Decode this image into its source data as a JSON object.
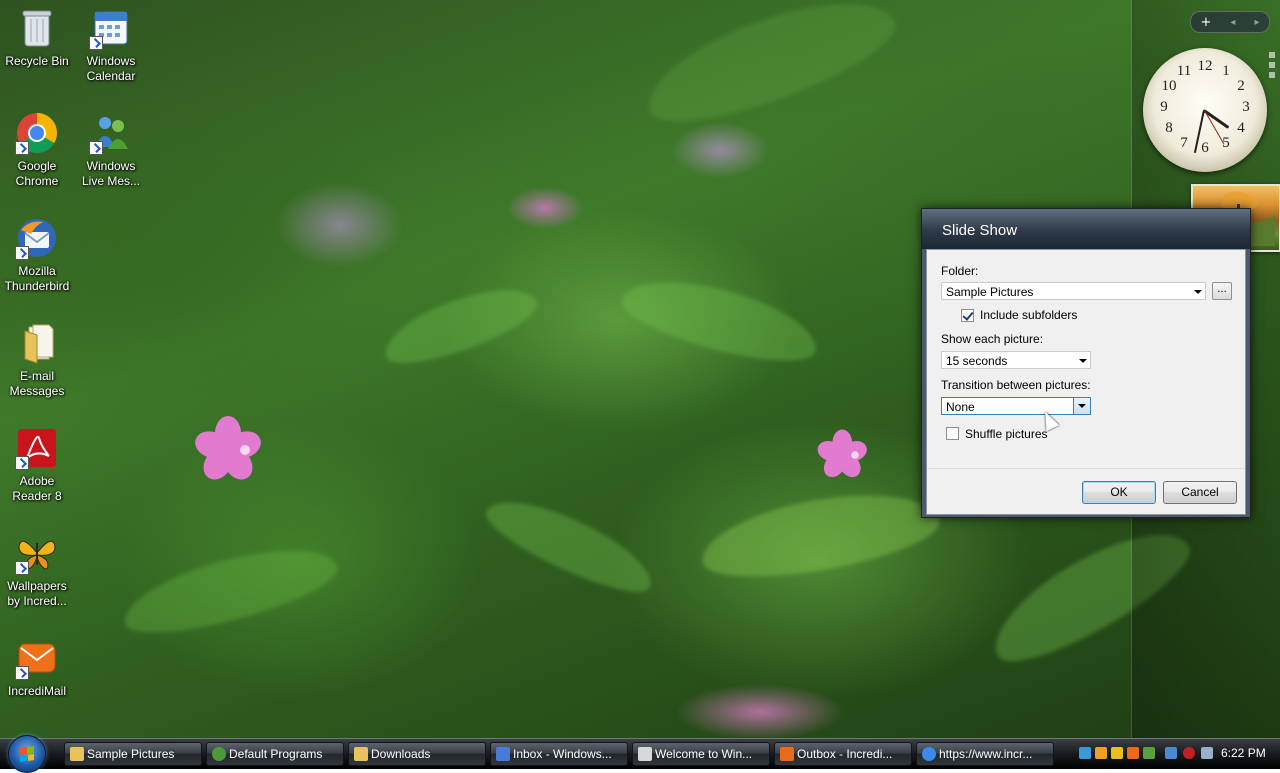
{
  "desktop_icons": [
    {
      "label": "Recycle Bin",
      "icon": "recycle-bin-icon"
    },
    {
      "label": "Windows\nCalendar",
      "icon": "calendar-icon"
    },
    {
      "label": "Google\nChrome",
      "icon": "chrome-icon"
    },
    {
      "label": "Windows\nLive Mes...",
      "icon": "messenger-icon"
    },
    {
      "label": "Mozilla\nThunderbird",
      "icon": "thunderbird-icon"
    },
    {
      "label": "E-mail\nMessages",
      "icon": "folder-icon"
    },
    {
      "label": "Adobe\nReader 8",
      "icon": "adobe-reader-icon"
    },
    {
      "label": "Wallpapers\nby Incred...",
      "icon": "butterfly-icon"
    },
    {
      "label": "IncrediMail",
      "icon": "incredimail-icon"
    }
  ],
  "sidebar": {
    "add_label": "+",
    "prev_label": "◂",
    "next_label": "▸",
    "clock_numbers": [
      "12",
      "1",
      "2",
      "3",
      "4",
      "5",
      "6",
      "7",
      "8",
      "9",
      "10",
      "11"
    ]
  },
  "dialog": {
    "title": "Slide Show",
    "folder_label": "Folder:",
    "folder_value": "Sample Pictures",
    "browse_label": "...",
    "include_subfolders_label": "Include subfolders",
    "include_subfolders_checked": true,
    "show_each_label": "Show each picture:",
    "show_each_value": "15 seconds",
    "transition_label": "Transition between pictures:",
    "transition_value": "None",
    "shuffle_label": "Shuffle pictures",
    "shuffle_checked": false,
    "ok_label": "OK",
    "cancel_label": "Cancel"
  },
  "taskbar": {
    "items": [
      {
        "label": "Sample Pictures",
        "icon": "folder-icon",
        "color": "#e8c25a"
      },
      {
        "label": "Default Programs",
        "icon": "default-programs-icon",
        "color": "#4a9a3a"
      },
      {
        "label": "Downloads",
        "icon": "folder-icon",
        "color": "#e8c25a"
      },
      {
        "label": "Inbox - Windows...",
        "icon": "mail-icon",
        "color": "#4a7ad8"
      },
      {
        "label": "Welcome to Win...",
        "icon": "welcome-icon",
        "color": "#d8d8d8"
      },
      {
        "label": "Outbox - Incredi...",
        "icon": "incredimail-icon",
        "color": "#e86a1a"
      },
      {
        "label": "https://www.incr...",
        "icon": "ie-icon",
        "color": "#3a8ae8"
      }
    ],
    "time": "6:22 PM"
  },
  "colors": {
    "dialog_title": "#2d3a48",
    "taskbar": "#1a1d21",
    "start_button": "#1e5aa6"
  }
}
